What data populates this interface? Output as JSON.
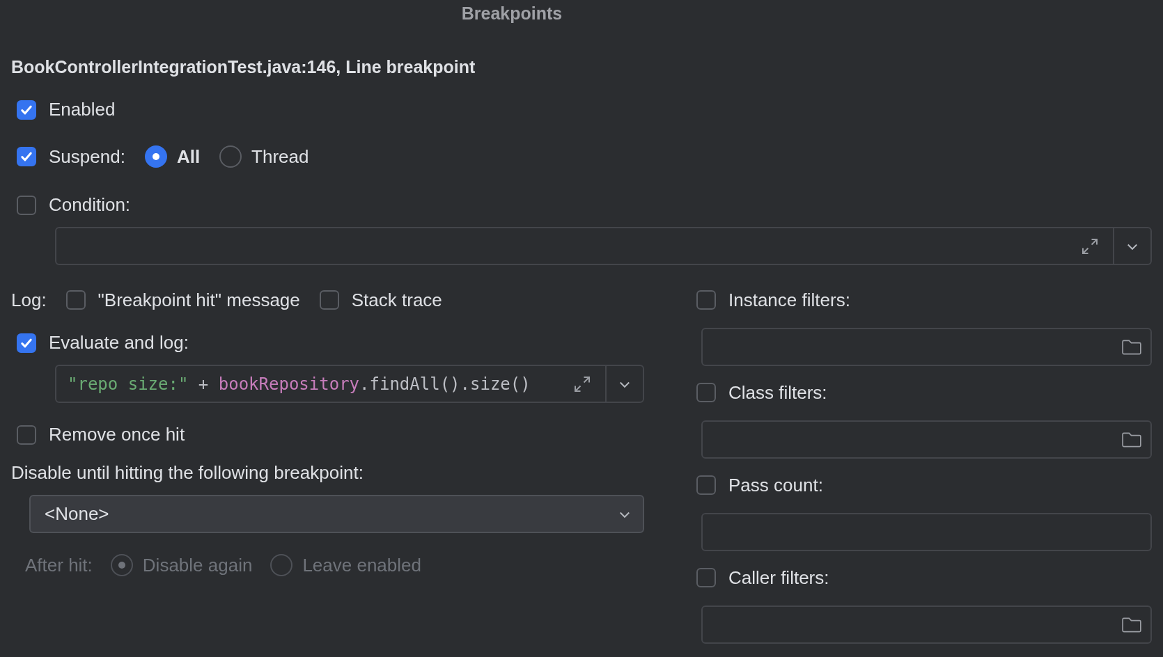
{
  "dialog": {
    "title": "Breakpoints"
  },
  "breakpoint_title": "BookControllerIntegrationTest.java:146, Line breakpoint",
  "enabled": {
    "label": "Enabled",
    "checked": true
  },
  "suspend": {
    "label": "Suspend:",
    "checked": true,
    "options": [
      {
        "label": "All",
        "selected": true
      },
      {
        "label": "Thread",
        "selected": false
      }
    ]
  },
  "condition": {
    "label": "Condition:",
    "checked": false
  },
  "log": {
    "label": "Log:",
    "options": [
      {
        "label": "\"Breakpoint hit\" message",
        "checked": false
      },
      {
        "label": "Stack trace",
        "checked": false
      }
    ]
  },
  "evaluate": {
    "label": "Evaluate and log:",
    "checked": true,
    "expression": [
      {
        "kind": "string",
        "text": "\"repo size:\""
      },
      {
        "kind": "plain",
        "text": " + "
      },
      {
        "kind": "field",
        "text": "bookRepository"
      },
      {
        "kind": "plain",
        "text": ".findAll().size()"
      }
    ]
  },
  "remove_once_hit": {
    "label": "Remove once hit",
    "checked": false
  },
  "disable_until": {
    "label": "Disable until hitting the following breakpoint:",
    "value": "<None>"
  },
  "after_hit": {
    "label": "After hit:",
    "disabled": true,
    "options": [
      {
        "label": "Disable again",
        "selected": true
      },
      {
        "label": "Leave enabled",
        "selected": false
      }
    ]
  },
  "filters": [
    {
      "kind": "browse",
      "label": "Instance filters:",
      "checked": false
    },
    {
      "kind": "browse",
      "label": "Class filters:",
      "checked": false
    },
    {
      "kind": "plain",
      "label": "Pass count:",
      "checked": false
    },
    {
      "kind": "browse",
      "label": "Caller filters:",
      "checked": false
    }
  ]
}
